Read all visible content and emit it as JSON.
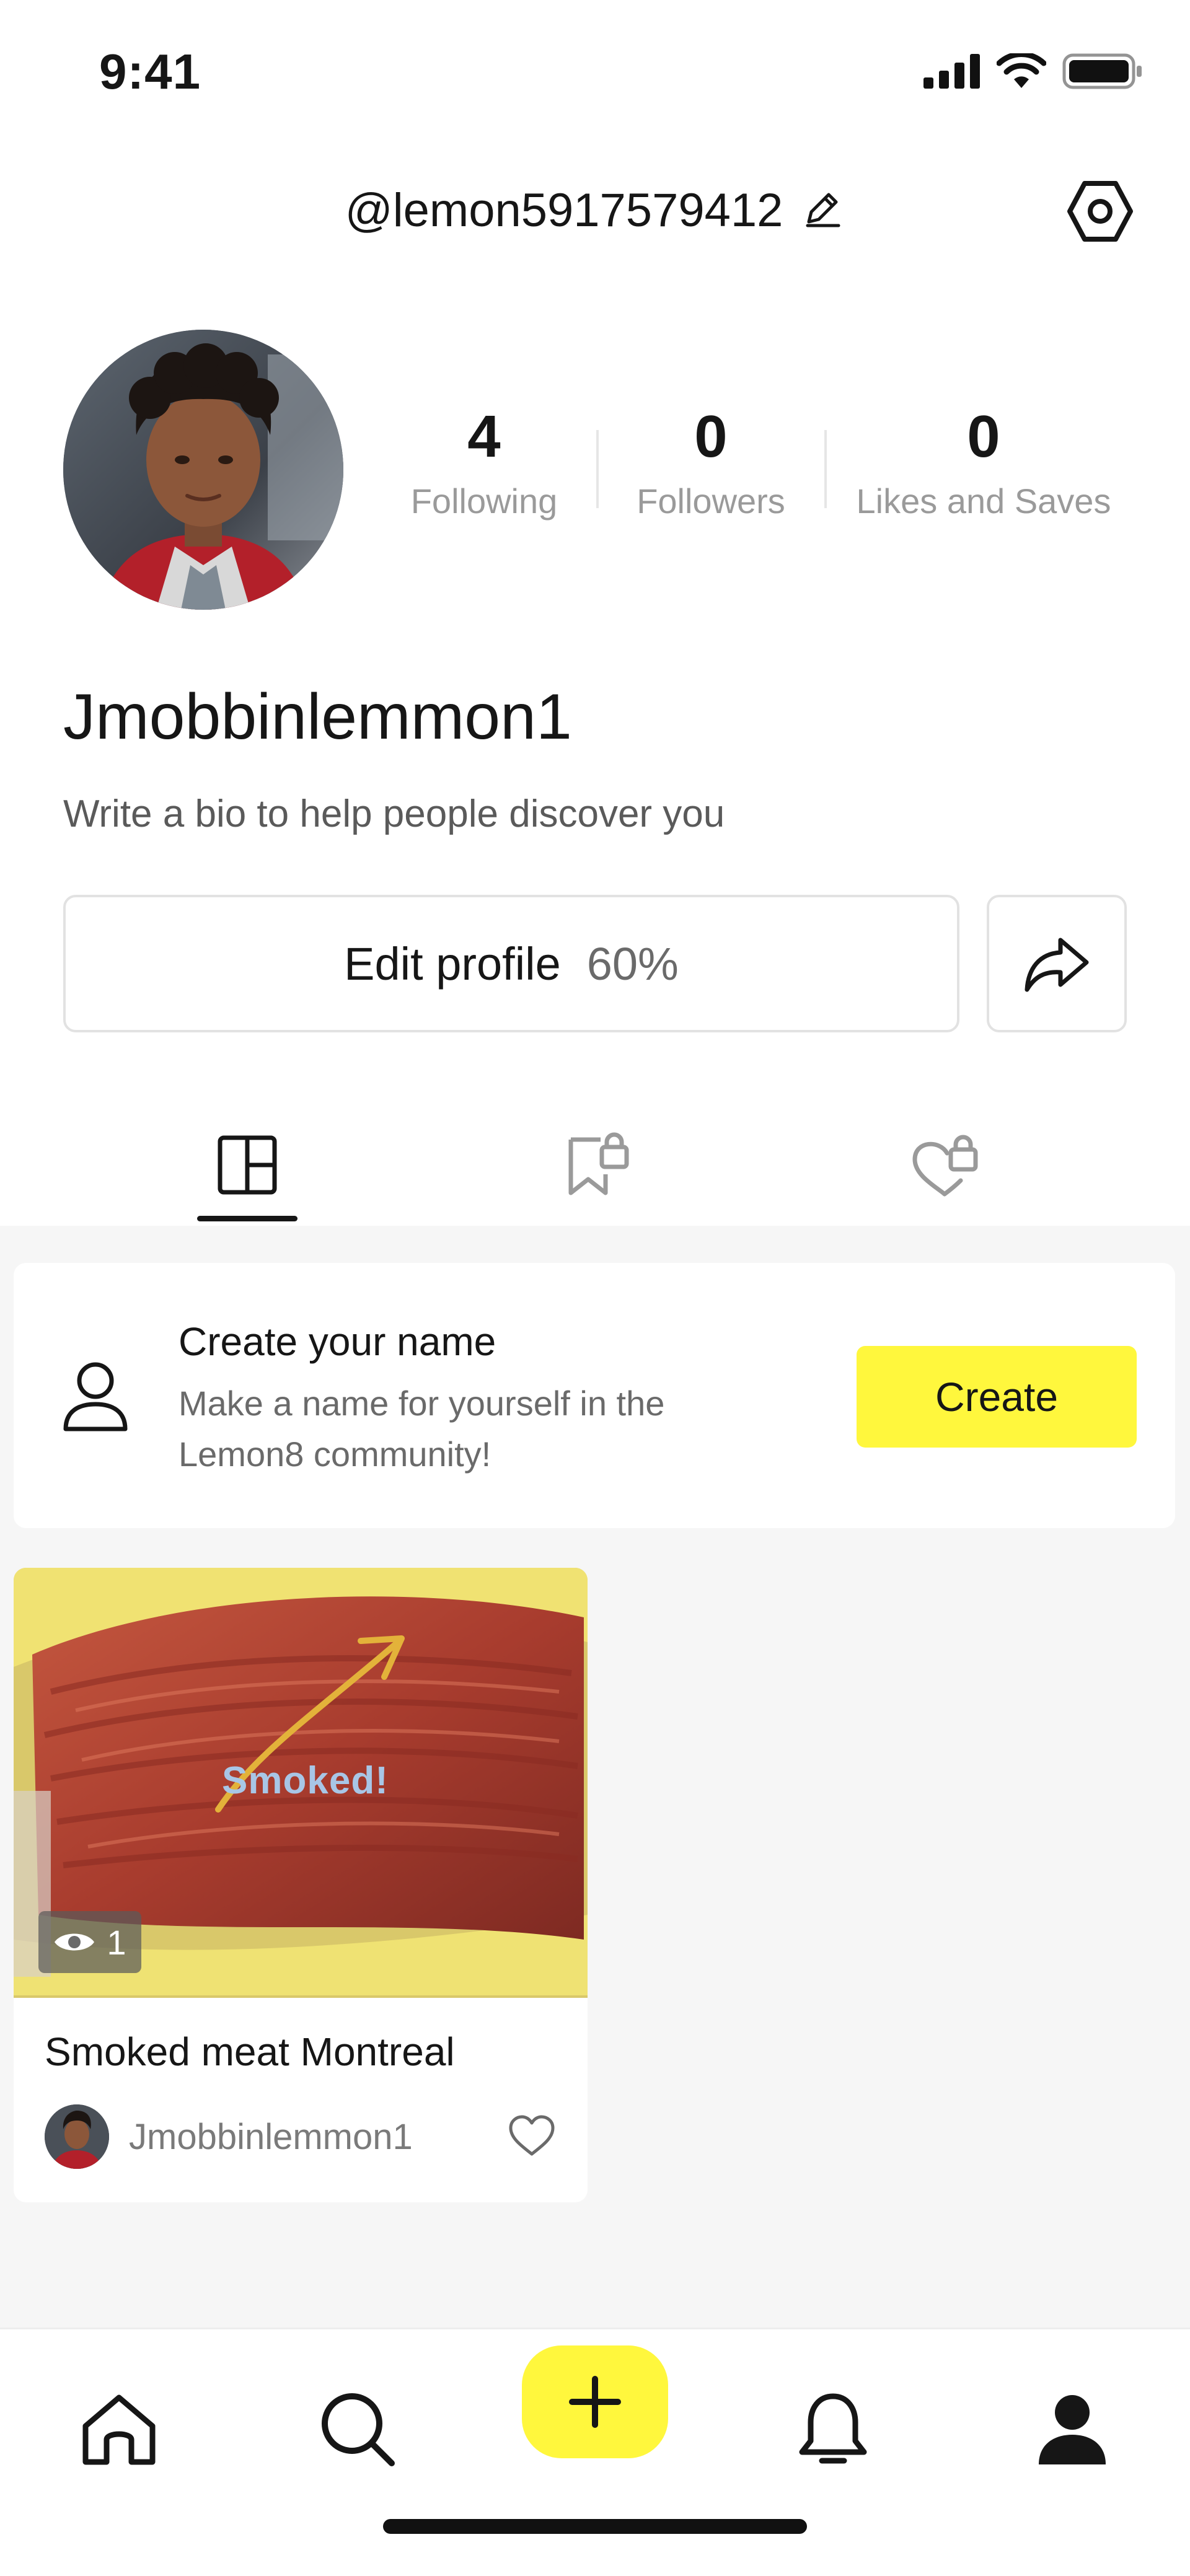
{
  "status_bar": {
    "time": "9:41"
  },
  "header": {
    "handle": "@lemon5917579412"
  },
  "profile": {
    "display_name": "Jmobbinlemmon1",
    "bio_placeholder": "Write a bio to help people discover you",
    "stats": [
      {
        "value": "4",
        "label": "Following"
      },
      {
        "value": "0",
        "label": "Followers"
      },
      {
        "value": "0",
        "label": "Likes and Saves"
      }
    ],
    "edit_profile_label": "Edit profile",
    "edit_profile_progress": "60%"
  },
  "tabs": [
    {
      "icon": "grid-icon",
      "active": true
    },
    {
      "icon": "bookmark-lock-icon",
      "active": false
    },
    {
      "icon": "heart-lock-icon",
      "active": false
    }
  ],
  "create_name_card": {
    "title": "Create your name",
    "description": "Make a name for yourself in the Lemon8 community!",
    "button_label": "Create"
  },
  "posts": [
    {
      "title": "Smoked meat Montreal",
      "author": "Jmobbinlemmon1",
      "views": "1",
      "image_caption": "Smoked!"
    }
  ],
  "bottom_nav": [
    {
      "icon": "home-icon"
    },
    {
      "icon": "search-icon"
    },
    {
      "icon": "plus-icon"
    },
    {
      "icon": "bell-icon"
    },
    {
      "icon": "profile-icon",
      "active": true
    }
  ],
  "colors": {
    "accent": "#fff73d",
    "text": "#161616",
    "muted": "#9a9a9a",
    "background": "#f6f6f6"
  }
}
